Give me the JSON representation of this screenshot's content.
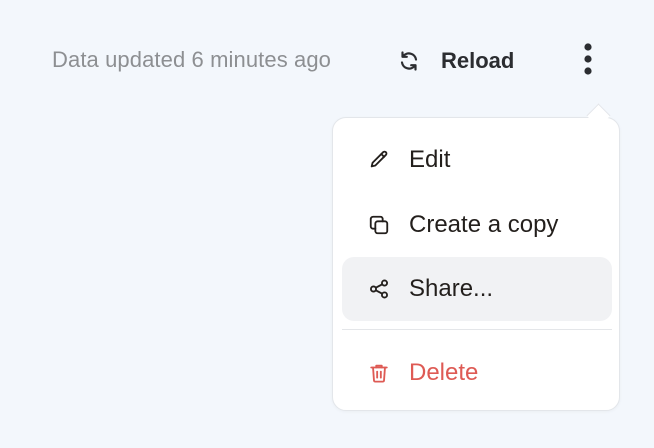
{
  "toolbar": {
    "updated_text": "Data updated 6 minutes ago",
    "reload_label": "Reload",
    "reload_icon": "refresh-icon",
    "more_icon": "kebab-menu-icon"
  },
  "menu": {
    "items": [
      {
        "label": "Edit",
        "icon": "pencil-icon"
      },
      {
        "label": "Create a copy",
        "icon": "copy-icon"
      },
      {
        "label": "Share...",
        "icon": "share-icon",
        "state": "hovered"
      },
      {
        "label": "Delete",
        "icon": "trash-icon",
        "variant": "danger"
      }
    ]
  },
  "colors": {
    "background": "#f3f7fc",
    "muted_text": "#8d8f92",
    "text": "#231f1c",
    "danger": "#de5a54",
    "hover": "#f1f2f4"
  }
}
